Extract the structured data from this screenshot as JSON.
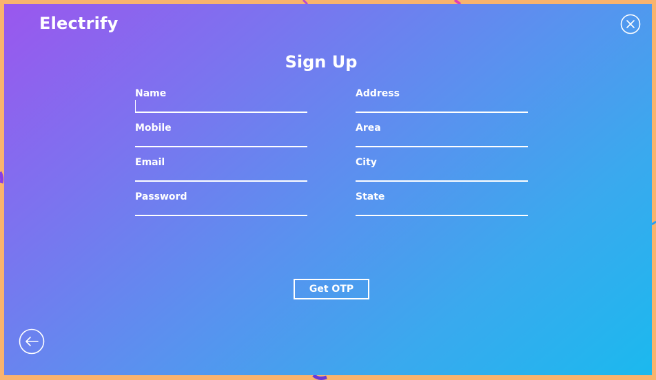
{
  "app": {
    "brand": "Electrify"
  },
  "icons": {
    "close": "close-icon",
    "back": "arrow-left-icon"
  },
  "form": {
    "title": "Sign Up",
    "left_fields": [
      {
        "label": "Name",
        "value": ""
      },
      {
        "label": "Mobile",
        "value": ""
      },
      {
        "label": "Email",
        "value": ""
      },
      {
        "label": "Password",
        "value": ""
      }
    ],
    "right_fields": [
      {
        "label": "Address",
        "value": ""
      },
      {
        "label": "Area",
        "value": ""
      },
      {
        "label": "City",
        "value": ""
      },
      {
        "label": "State",
        "value": ""
      }
    ],
    "submit_label": "Get OTP"
  },
  "colors": {
    "gradient_start": "#9a57ee",
    "gradient_end": "#1bb9ee",
    "frame": "#f9b36e",
    "foreground": "#ffffff"
  }
}
